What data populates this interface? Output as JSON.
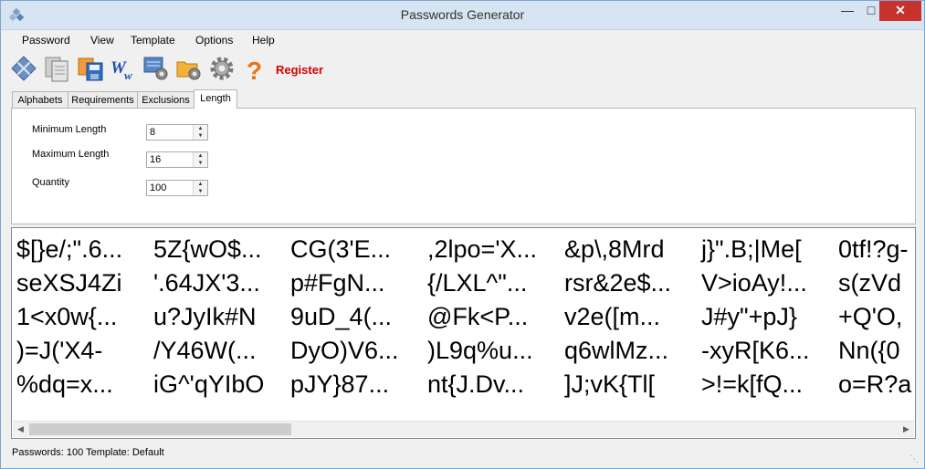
{
  "window": {
    "title": "Passwords Generator"
  },
  "menu": [
    "Password",
    "View",
    "Template",
    "Options",
    "Help"
  ],
  "toolbar": {
    "icons": [
      "diamond-grid-icon",
      "copy-pages-icon",
      "save-disk-icon",
      "word-document-icon",
      "settings-monitor-icon",
      "folder-settings-icon",
      "gear-icon",
      "help-icon"
    ],
    "register_label": "Register"
  },
  "tabs": [
    "Alphabets",
    "Requirements",
    "Exclusions",
    "Length"
  ],
  "length": {
    "min_label": "Minimum Length",
    "min_value": "8",
    "max_label": "Maximum Length",
    "max_value": "16",
    "qty_label": "Quantity",
    "qty_value": "100"
  },
  "passwords": [
    [
      "$[}e/;\".6...",
      "seXSJ4Zi",
      "1<x0w{...",
      ")=J('X4-",
      "%dq=x..."
    ],
    [
      "5Z{wO$...",
      "'.64JX'3...",
      "u?JyIk#N",
      "/Y46W(...",
      "iG^'qYIbO"
    ],
    [
      "CG(3'E...",
      "p#FgN...",
      "9uD_4(...",
      "DyO)V6...",
      "pJY}87..."
    ],
    [
      ",2lpo='X...",
      "{/LXL^\"...",
      "@Fk<P...",
      ")L9q%u...",
      "nt{J.Dv..."
    ],
    [
      "&p\\,8Mrd",
      "rsr&2e$...",
      "v2e([m...",
      "q6wlMz...",
      "]J;vK{Tl["
    ],
    [
      "j}\".B;|Me[",
      "V>ioAy!...",
      "J#y\"+pJ}",
      "-xyR[K6...",
      ">!=k[fQ..."
    ],
    [
      "0tf!?g-",
      "s(zVd",
      "+Q'O,",
      "Nn({0",
      "o=R?a"
    ]
  ],
  "status": {
    "text": "Passwords: 100   Template: Default"
  }
}
